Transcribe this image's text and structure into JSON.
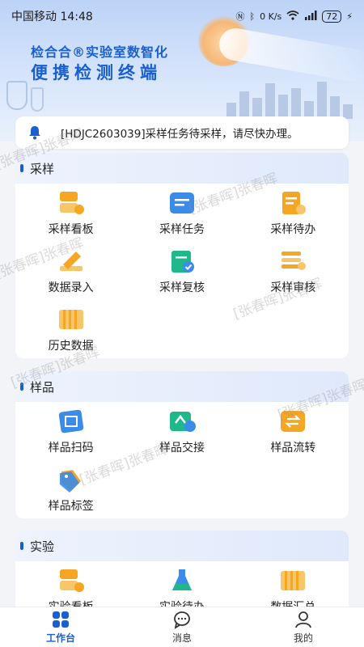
{
  "status_bar": {
    "carrier": "中国移动",
    "time": "14:48",
    "net_speed": "0 K/s",
    "battery": "72"
  },
  "header": {
    "brand_line1": "检合合®实验室数智化",
    "brand_line2": "便携检测终端"
  },
  "notice": {
    "text": "[HDJC2603039]采样任务待采样，请尽快办理。"
  },
  "sections": [
    {
      "title": "采样",
      "items": [
        {
          "label": "采样看板",
          "icon": "sampling-dashboard-icon"
        },
        {
          "label": "采样任务",
          "icon": "sampling-task-icon"
        },
        {
          "label": "采样待办",
          "icon": "sampling-todo-icon"
        },
        {
          "label": "数据录入",
          "icon": "data-entry-icon"
        },
        {
          "label": "采样复核",
          "icon": "sampling-review-icon"
        },
        {
          "label": "采样审核",
          "icon": "sampling-audit-icon"
        },
        {
          "label": "历史数据",
          "icon": "history-data-icon"
        }
      ]
    },
    {
      "title": "样品",
      "items": [
        {
          "label": "样品扫码",
          "icon": "sample-scan-icon"
        },
        {
          "label": "样品交接",
          "icon": "sample-handover-icon"
        },
        {
          "label": "样品流转",
          "icon": "sample-flow-icon"
        },
        {
          "label": "样品标签",
          "icon": "sample-label-icon"
        }
      ]
    },
    {
      "title": "实验",
      "items": [
        {
          "label": "实验看板",
          "icon": "lab-dashboard-icon"
        },
        {
          "label": "实验待办",
          "icon": "lab-todo-icon"
        },
        {
          "label": "数据汇总",
          "icon": "data-summary-icon"
        }
      ]
    }
  ],
  "watermark": "[张春晖]张春晖",
  "tabbar": {
    "items": [
      {
        "label": "工作台",
        "icon": "workbench-icon",
        "active": true
      },
      {
        "label": "消息",
        "icon": "message-icon",
        "active": false
      },
      {
        "label": "我的",
        "icon": "profile-icon",
        "active": false
      }
    ]
  },
  "colors": {
    "accent": "#1a5fd1",
    "icon_orange": "#f5a623",
    "icon_blue": "#3b8be8",
    "icon_green": "#1fb88a"
  }
}
